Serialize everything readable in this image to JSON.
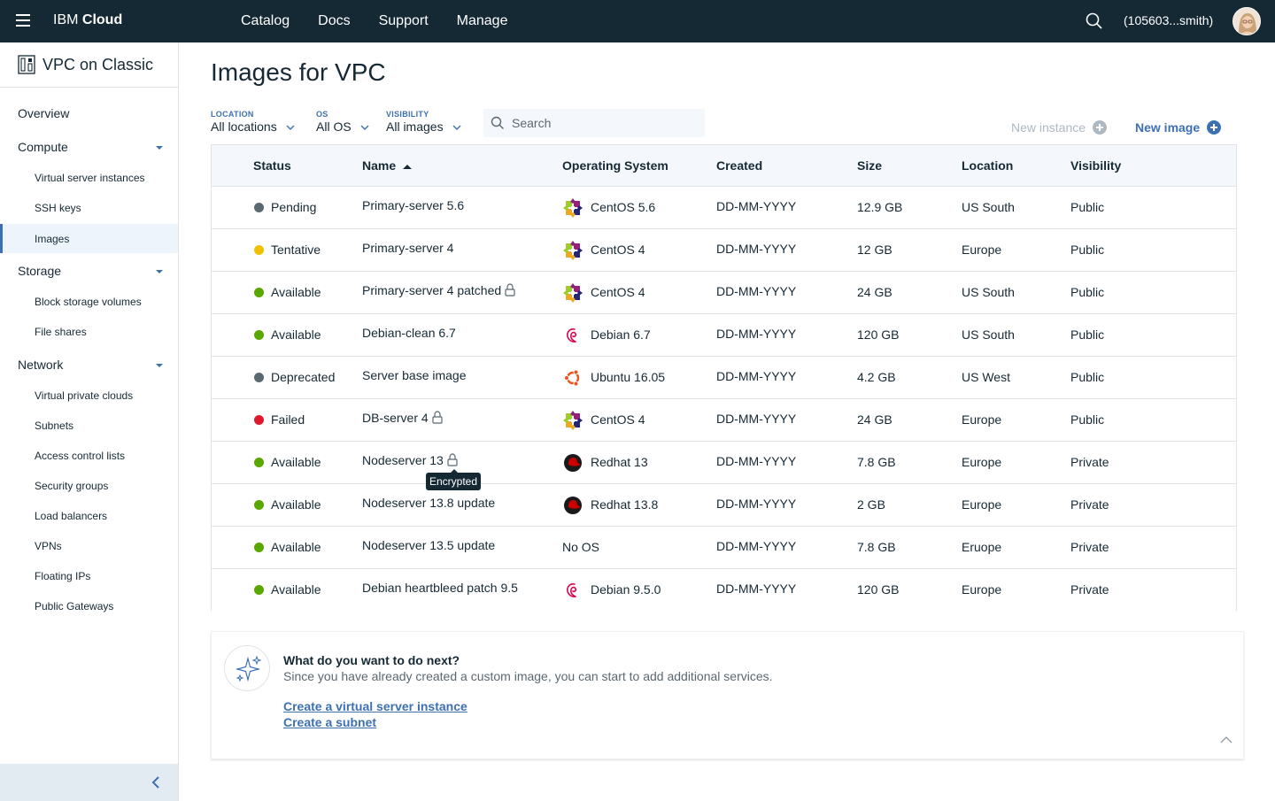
{
  "topbar": {
    "brand_prefix": "IBM",
    "brand_bold": "Cloud",
    "nav": [
      "Catalog",
      "Docs",
      "Support",
      "Manage"
    ],
    "account": "(105603...smith)",
    "icons": [
      "menu-icon",
      "search-icon",
      "avatar"
    ]
  },
  "sidebar": {
    "title": "VPC on Classic",
    "overview": "Overview",
    "sections": {
      "compute": {
        "label": "Compute",
        "items": [
          "Virtual server instances",
          "SSH keys",
          "Images"
        ]
      },
      "storage": {
        "label": "Storage",
        "items": [
          "Block storage volumes",
          "File shares"
        ]
      },
      "network": {
        "label": "Network",
        "items": [
          "Virtual private clouds",
          "Subnets",
          "Access control lists",
          "Security groups",
          "Load balancers",
          "VPNs",
          "Floating IPs",
          "Public Gateways"
        ]
      }
    },
    "active_item": "Images"
  },
  "page": {
    "title": "Images for VPC"
  },
  "filters": {
    "location": {
      "label": "LOCATION",
      "value": "All locations"
    },
    "os": {
      "label": "OS",
      "value": "All OS"
    },
    "visibility": {
      "label": "VISIBILITY",
      "value": "All images"
    }
  },
  "search": {
    "placeholder": "Search"
  },
  "actions": {
    "new_instance": "New instance",
    "new_image": "New image"
  },
  "table": {
    "columns": [
      "Status",
      "Name",
      "Operating System",
      "Created",
      "Size",
      "Location",
      "Visibility"
    ],
    "sorted_by": "Name",
    "rows": [
      {
        "status": "Pending",
        "status_color": "#5a6872",
        "name": "Primary-server 5.6",
        "locked": false,
        "os": "CentOS 5.6",
        "os_icon": "centos-icon",
        "created": "DD-MM-YYYY",
        "size": "12.9 GB",
        "location": "US South",
        "visibility": "Public"
      },
      {
        "status": "Tentative",
        "status_color": "#efc100",
        "name": "Primary-server 4",
        "locked": false,
        "os": "CentOS 4",
        "os_icon": "centos-icon",
        "created": "DD-MM-YYYY",
        "size": "12 GB",
        "location": "Europe",
        "visibility": "Public"
      },
      {
        "status": "Available",
        "status_color": "#5aa700",
        "name": "Primary-server 4 patched",
        "locked": true,
        "os": "CentOS 4",
        "os_icon": "centos-icon",
        "created": "DD-MM-YYYY",
        "size": "24 GB",
        "location": "US South",
        "visibility": "Public"
      },
      {
        "status": "Available",
        "status_color": "#5aa700",
        "name": "Debian-clean 6.7",
        "locked": false,
        "os": "Debian 6.7",
        "os_icon": "debian-icon",
        "created": "DD-MM-YYYY",
        "size": "120 GB",
        "location": "US South",
        "visibility": "Public"
      },
      {
        "status": "Deprecated",
        "status_color": "#5a6872",
        "name": "Server base image",
        "locked": false,
        "os": "Ubuntu 16.05",
        "os_icon": "ubuntu-icon",
        "created": "DD-MM-YYYY",
        "size": "4.2 GB",
        "location": "US West",
        "visibility": "Public"
      },
      {
        "status": "Failed",
        "status_color": "#e0182d",
        "name": "DB-server 4",
        "locked": true,
        "os": "CentOS 4",
        "os_icon": "centos-icon",
        "created": "DD-MM-YYYY",
        "size": "24 GB",
        "location": "Europe",
        "visibility": "Public"
      },
      {
        "status": "Available",
        "status_color": "#5aa700",
        "name": "Nodeserver 13",
        "locked": true,
        "os": "Redhat 13",
        "os_icon": "redhat-icon",
        "created": "DD-MM-YYYY",
        "size": "7.8 GB",
        "location": "Europe",
        "visibility": "Private"
      },
      {
        "status": "Available",
        "status_color": "#5aa700",
        "name": "Nodeserver 13.8 update",
        "locked": false,
        "os": "Redhat 13.8",
        "os_icon": "redhat-icon",
        "created": "DD-MM-YYYY",
        "size": "2 GB",
        "location": "Europe",
        "visibility": "Private"
      },
      {
        "status": "Available",
        "status_color": "#5aa700",
        "name": "Nodeserver 13.5 update",
        "locked": false,
        "os": "No OS",
        "os_icon": "",
        "created": "DD-MM-YYYY",
        "size": "7.8 GB",
        "location": "Eruope",
        "visibility": "Private"
      },
      {
        "status": "Available",
        "status_color": "#5aa700",
        "name": "Debian heartbleed patch 9.5",
        "locked": false,
        "os": "Debian 9.5.0",
        "os_icon": "debian-icon",
        "created": "DD-MM-YYYY",
        "size": "120 GB",
        "location": "Europe",
        "visibility": "Private"
      }
    ]
  },
  "tooltip": {
    "text": "Encrypted"
  },
  "next_steps": {
    "title": "What do you want to do next?",
    "description": "Since you have already created a custom image, you can start to add additional services.",
    "links": [
      "Create a virtual server instance",
      "Create a subnet"
    ]
  },
  "colors": {
    "header_bg": "#152935",
    "accent": "#3d70b2",
    "disabled": "#aeb8c2"
  }
}
